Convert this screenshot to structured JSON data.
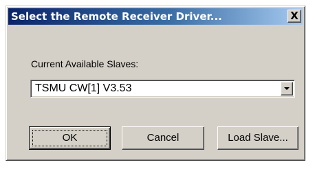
{
  "window": {
    "title": "Select the Remote Receiver Driver...",
    "close_glyph": "X"
  },
  "slaves": {
    "label": "Current Available Slaves:",
    "selected": "TSMU CW[1] V3.53"
  },
  "buttons": {
    "ok": "OK",
    "cancel": "Cancel",
    "load_slave": "Load Slave..."
  },
  "colors": {
    "titlebar_start": "#0a246a",
    "titlebar_end": "#a6caf0",
    "face": "#d4d0c8"
  },
  "icons": {
    "close": "close-icon",
    "dropdown": "chevron-down-icon"
  }
}
